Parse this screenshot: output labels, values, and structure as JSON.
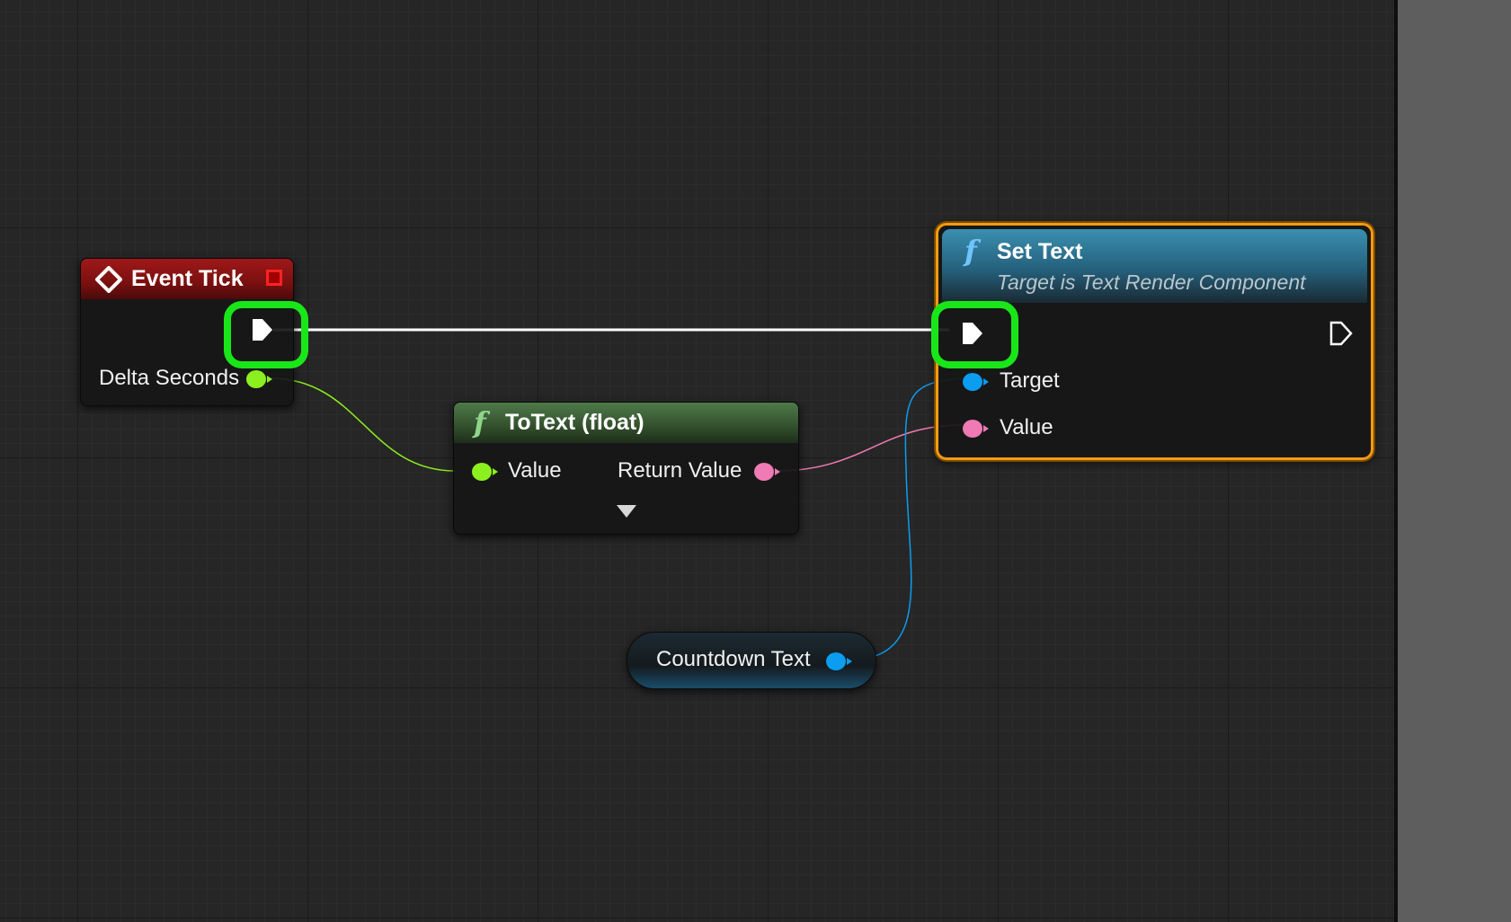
{
  "colors": {
    "canvas_bg": "#262626",
    "event_header": "#8c1414",
    "func_header_green": "#3b5a39",
    "func_header_blue": "#2a6a8a",
    "exec_wire": "#ffffff",
    "float_pin": "#8cf01e",
    "text_pin": "#f07ab4",
    "object_pin": "#0a9df0",
    "highlight": "#19e619",
    "selection": "#f59a10"
  },
  "nodes": {
    "event_tick": {
      "title": "Event Tick",
      "icon": "event-diamond-icon",
      "outputs": {
        "delta_seconds": "Delta Seconds"
      }
    },
    "to_text": {
      "title": "ToText (float)",
      "icon": "function-icon",
      "inputs": {
        "value": "Value"
      },
      "outputs": {
        "return_value": "Return Value"
      },
      "expand_icon": "chevron-down-icon"
    },
    "set_text": {
      "title": "Set Text",
      "subtitle": "Target is Text Render Component",
      "icon": "function-icon",
      "inputs": {
        "target": "Target",
        "value": "Value"
      }
    },
    "countdown_text": {
      "label": "Countdown Text"
    }
  },
  "annotations": [
    "exec-output-highlight",
    "exec-input-highlight"
  ]
}
